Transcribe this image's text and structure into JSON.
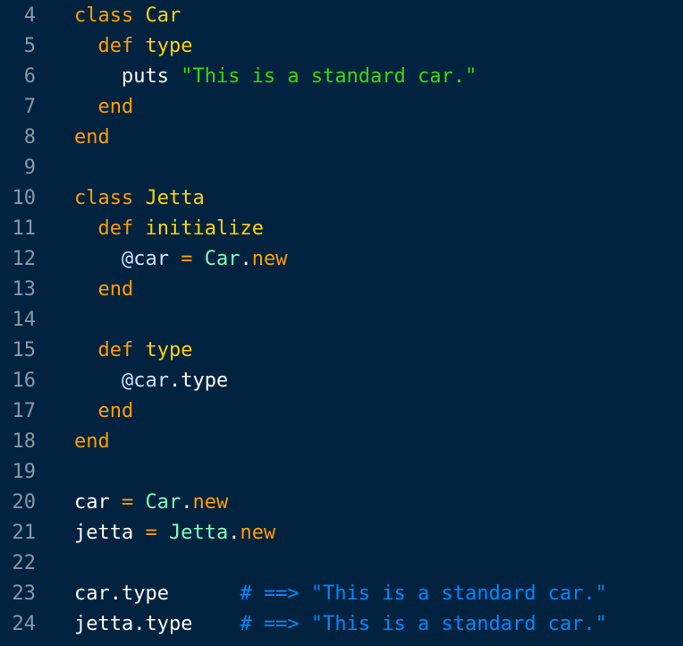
{
  "editor": {
    "lines": [
      {
        "num": "4",
        "tokens": [
          {
            "t": "class ",
            "c": "kw"
          },
          {
            "t": "Car",
            "c": "cls"
          }
        ]
      },
      {
        "num": "5",
        "tokens": [
          {
            "t": "  def ",
            "c": "kw"
          },
          {
            "t": "type",
            "c": "cls"
          }
        ]
      },
      {
        "num": "6",
        "tokens": [
          {
            "t": "    puts ",
            "c": "txt"
          },
          {
            "t": "\"This is a standard car.\"",
            "c": "str"
          }
        ]
      },
      {
        "num": "7",
        "tokens": [
          {
            "t": "  end",
            "c": "kw"
          }
        ]
      },
      {
        "num": "8",
        "tokens": [
          {
            "t": "end",
            "c": "kw"
          }
        ]
      },
      {
        "num": "9",
        "tokens": []
      },
      {
        "num": "10",
        "tokens": [
          {
            "t": "class ",
            "c": "kw"
          },
          {
            "t": "Jetta",
            "c": "cls"
          }
        ]
      },
      {
        "num": "11",
        "tokens": [
          {
            "t": "  def ",
            "c": "kw"
          },
          {
            "t": "initialize",
            "c": "cls"
          }
        ]
      },
      {
        "num": "12",
        "tokens": [
          {
            "t": "    @car ",
            "c": "ivar"
          },
          {
            "t": "= ",
            "c": "op"
          },
          {
            "t": "Car",
            "c": "const"
          },
          {
            "t": ".",
            "c": "txt"
          },
          {
            "t": "new",
            "c": "kw"
          }
        ]
      },
      {
        "num": "13",
        "tokens": [
          {
            "t": "  end",
            "c": "kw"
          }
        ]
      },
      {
        "num": "14",
        "tokens": []
      },
      {
        "num": "15",
        "tokens": [
          {
            "t": "  def ",
            "c": "kw"
          },
          {
            "t": "type",
            "c": "cls"
          }
        ]
      },
      {
        "num": "16",
        "tokens": [
          {
            "t": "    @car",
            "c": "ivar"
          },
          {
            "t": ".type",
            "c": "txt"
          }
        ]
      },
      {
        "num": "17",
        "tokens": [
          {
            "t": "  end",
            "c": "kw"
          }
        ]
      },
      {
        "num": "18",
        "tokens": [
          {
            "t": "end",
            "c": "kw"
          }
        ]
      },
      {
        "num": "19",
        "tokens": []
      },
      {
        "num": "20",
        "tokens": [
          {
            "t": "car ",
            "c": "txt"
          },
          {
            "t": "= ",
            "c": "op"
          },
          {
            "t": "Car",
            "c": "const"
          },
          {
            "t": ".",
            "c": "txt"
          },
          {
            "t": "new",
            "c": "kw"
          }
        ]
      },
      {
        "num": "21",
        "tokens": [
          {
            "t": "jetta ",
            "c": "txt"
          },
          {
            "t": "= ",
            "c": "op"
          },
          {
            "t": "Jetta",
            "c": "const"
          },
          {
            "t": ".",
            "c": "txt"
          },
          {
            "t": "new",
            "c": "kw"
          }
        ]
      },
      {
        "num": "22",
        "tokens": []
      },
      {
        "num": "23",
        "tokens": [
          {
            "t": "car.type      ",
            "c": "txt"
          },
          {
            "t": "# ==> \"This is a standard car.\"",
            "c": "cmt"
          }
        ]
      },
      {
        "num": "24",
        "tokens": [
          {
            "t": "jetta.type    ",
            "c": "txt"
          },
          {
            "t": "# ==> \"This is a standard car.\"",
            "c": "cmt"
          }
        ]
      }
    ]
  },
  "colors": {
    "background": "#012340",
    "line_number": "#8a96a6",
    "keyword": "#ff9d00",
    "class_name": "#ffd200",
    "string": "#3ad900",
    "constant": "#80ffbb",
    "comment": "#0088ff",
    "text": "#ffffff"
  }
}
